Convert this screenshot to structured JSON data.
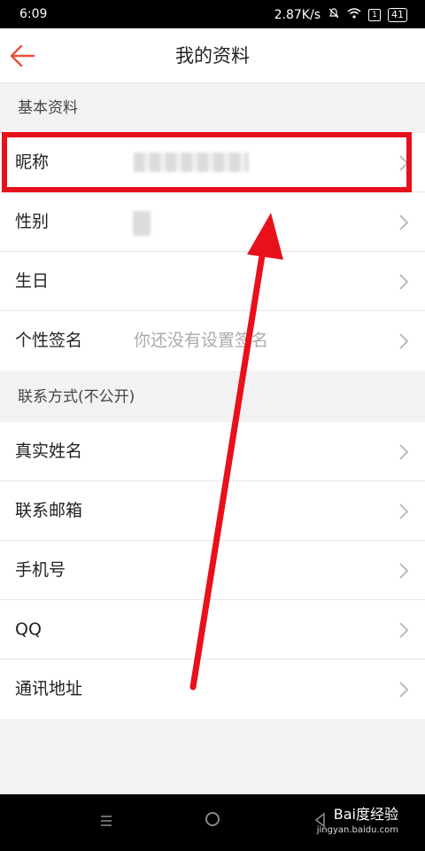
{
  "status_bar": {
    "time": "6:09",
    "network_speed": "2.87K/s",
    "sim_indicator": "1",
    "battery": "41"
  },
  "header": {
    "title": "我的资料",
    "back_icon": "arrow-left-icon",
    "accent_color": "#e8503c"
  },
  "sections": [
    {
      "title": "基本资料",
      "rows": [
        {
          "label": "昵称",
          "value": ""
        },
        {
          "label": "性别",
          "value": ""
        },
        {
          "label": "生日",
          "value": ""
        },
        {
          "label": "个性签名",
          "value": "你还没有设置签名"
        }
      ]
    },
    {
      "title": "联系方式(不公开)",
      "rows": [
        {
          "label": "真实姓名",
          "value": ""
        },
        {
          "label": "联系邮箱",
          "value": ""
        },
        {
          "label": "手机号",
          "value": ""
        },
        {
          "label": "QQ",
          "value": ""
        },
        {
          "label": "通讯地址",
          "value": ""
        }
      ]
    }
  ],
  "annotation": {
    "color": "#e8101b",
    "highlight_target": "昵称"
  },
  "watermark": {
    "brand": "Bai度经验",
    "url": "jingyan.baidu.com"
  }
}
